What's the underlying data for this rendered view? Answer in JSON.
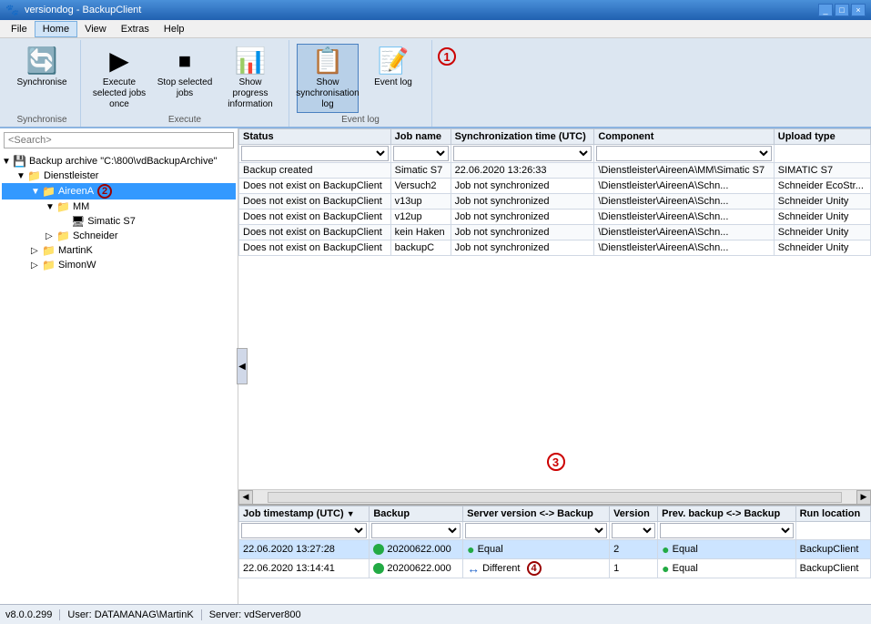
{
  "titlebar": {
    "title": "versiondog - BackupClient",
    "controls": [
      "_",
      "□",
      "×"
    ]
  },
  "menubar": {
    "items": [
      "File",
      "Home",
      "View",
      "Extras",
      "Help"
    ],
    "active": "Home"
  },
  "ribbon": {
    "groups": [
      {
        "label": "Synchronise",
        "buttons": [
          {
            "id": "synchronise",
            "text": "Synchronise",
            "icon": "🔄"
          }
        ]
      },
      {
        "label": "Execute",
        "buttons": [
          {
            "id": "execute-once",
            "text": "Execute selected jobs once",
            "icon": "▶"
          },
          {
            "id": "stop-jobs",
            "text": "Stop selected jobs",
            "icon": "⏹"
          },
          {
            "id": "show-progress",
            "text": "Show progress information",
            "icon": "📊"
          }
        ]
      },
      {
        "label": "Event log",
        "buttons": [
          {
            "id": "show-sync-log",
            "text": "Show synchronisation log",
            "icon": "📋",
            "active": true
          },
          {
            "id": "event-log",
            "text": "Event log",
            "icon": "📝"
          }
        ]
      }
    ],
    "badge1": "①",
    "badge1_num": "1"
  },
  "sidebar": {
    "search_placeholder": "<Search>",
    "tree": {
      "root_label": "Backup archive \"C:\\800\\vdBackupArchive\"",
      "items": [
        {
          "id": "root",
          "label": "Backup archive \"C:\\800\\vdBackupArchive\"",
          "level": 0,
          "type": "archive",
          "expanded": true
        },
        {
          "id": "dienstleister",
          "label": "Dienstleister",
          "level": 1,
          "type": "folder",
          "expanded": true
        },
        {
          "id": "aireena",
          "label": "AireenA",
          "level": 2,
          "type": "folder",
          "expanded": true,
          "selected": true
        },
        {
          "id": "mm",
          "label": "MM",
          "level": 3,
          "type": "folder",
          "expanded": true
        },
        {
          "id": "simatic-s7",
          "label": "Simatic S7",
          "level": 4,
          "type": "file"
        },
        {
          "id": "schneider",
          "label": "Schneider",
          "level": 3,
          "type": "folder",
          "expanded": false
        },
        {
          "id": "martink",
          "label": "MartinK",
          "level": 2,
          "type": "folder",
          "expanded": false
        },
        {
          "id": "simonw",
          "label": "SimonW",
          "level": 2,
          "type": "folder",
          "expanded": false
        }
      ]
    },
    "badge2_num": "2"
  },
  "upper_table": {
    "columns": [
      "Status",
      "Job name",
      "Synchronization time (UTC)",
      "Component",
      "Upload type"
    ],
    "rows": [
      {
        "status": "Backup created",
        "job": "Simatic S7",
        "sync_time": "22.06.2020 13:26:33",
        "component": "\\Dienstleister\\AireenA\\MM\\Simatic S7",
        "upload": "SIMATIC S7",
        "selected": false
      },
      {
        "status": "Does not exist on BackupClient",
        "job": "Versuch2",
        "sync_time": "Job not synchronized",
        "component": "\\Dienstleister\\AireenA\\Schn...",
        "upload": "Schneider EcoStr...",
        "selected": false
      },
      {
        "status": "Does not exist on BackupClient",
        "job": "v13up",
        "sync_time": "Job not synchronized",
        "component": "\\Dienstleister\\AireenA\\Schn...",
        "upload": "Schneider Unity",
        "selected": false
      },
      {
        "status": "Does not exist on BackupClient",
        "job": "v12up",
        "sync_time": "Job not synchronized",
        "component": "\\Dienstleister\\AireenA\\Schn...",
        "upload": "Schneider Unity",
        "selected": false
      },
      {
        "status": "Does not exist on BackupClient",
        "job": "kein Haken",
        "sync_time": "Job not synchronized",
        "component": "\\Dienstleister\\AireenA\\Schn...",
        "upload": "Schneider Unity",
        "selected": false
      },
      {
        "status": "Does not exist on BackupClient",
        "job": "backupC",
        "sync_time": "Job not synchronized",
        "component": "\\Dienstleister\\AireenA\\Schn...",
        "upload": "Schneider Unity",
        "selected": false
      }
    ],
    "badge3_num": "3"
  },
  "bottom_table": {
    "columns": [
      "Job timestamp (UTC)",
      "Backup",
      "Server version <-> Backup",
      "Version",
      "Prev. backup <-> Backup",
      "Run location"
    ],
    "rows": [
      {
        "timestamp": "22.06.2020 13:27:28",
        "backup": "20200622.000",
        "server_backup": "Equal",
        "version": "2",
        "prev_backup": "Equal",
        "run_location": "BackupClient",
        "selected": true,
        "sv_icon": "green",
        "pb_icon": "green"
      },
      {
        "timestamp": "22.06.2020 13:14:41",
        "backup": "20200622.000",
        "server_backup": "Different",
        "version": "1",
        "prev_backup": "Equal",
        "run_location": "BackupClient",
        "selected": false,
        "sv_icon": "blue",
        "pb_icon": "green"
      }
    ],
    "badge4_num": "4"
  },
  "statusbar": {
    "version": "v8.0.0.299",
    "user": "User: DATAMANAG\\MartinK",
    "server": "Server: vdServer800"
  }
}
